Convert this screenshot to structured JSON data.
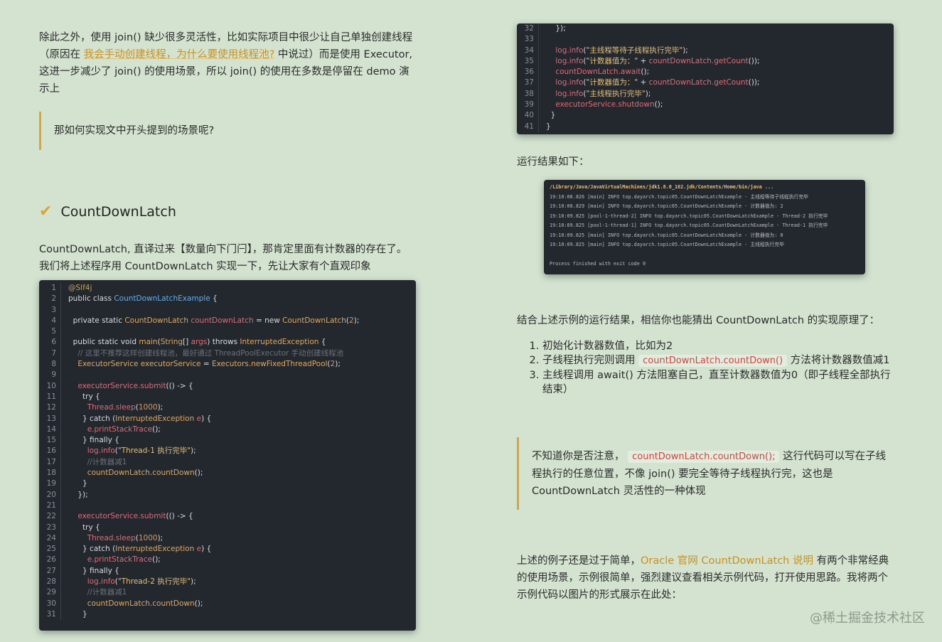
{
  "left": {
    "intro_pre": "除此之外，使用 join() 缺少很多灵活性，比如实际项目中很少让自己单独创建线程（原因在 ",
    "intro_link": "我会手动创建线程，为什么要使用线程池?",
    "intro_post": " 中说过）而是使用 Executor, 这进一步减少了 join() 的使用场景，所以 join() 的使用在多数是停留在 demo 演示上",
    "quote": "那如何实现文中开头提到的场景呢?",
    "heading": "CountDownLatch",
    "desc": "CountDownLatch, 直译过来【数量向下门闩】，那肯定里面有计数器的存在了。我们将上述程序用 CountDownLatch 实现一下，先让大家有个直观印象"
  },
  "right": {
    "result_label": "运行结果如下：",
    "summary": "结合上述示例的运行结果，相信你也能猜出 CountDownLatch 的实现原理了：",
    "steps": [
      {
        "pre": "初始化计数器数值，比如为2",
        "code": "",
        "post": ""
      },
      {
        "pre": "子线程执行完则调用 ",
        "code": "countDownLatch.countDown()",
        "post": " 方法将计数器数值减1"
      },
      {
        "pre": "主线程调用 await() 方法阻塞自己，直至计数器数值为0（即子线程全部执行结束）",
        "code": "",
        "post": ""
      }
    ],
    "quote_pre": "不知道你是否注意， ",
    "quote_code": "countDownLatch.countDown();",
    "quote_post": " 这行代码可以写在子线程执行的任意位置，不像 join() 要完全等待子线程执行完，这也是 CountDownLatch 灵活性的一种体现",
    "end_pre": "上述的例子还是过于简单，",
    "end_link": "Oracle 官网 CountDownLatch 说明",
    "end_post": " 有两个非常经典的使用场景，示例很简单，强烈建议查看相关示例代码，打开使用思路。我将两个示例代码以图片的形式展示在此处："
  },
  "terminal": [
    "/Library/Java/JavaVirtualMachines/jdk1.8.0_162.jdk/Contents/Home/bin/java ...",
    "19:10:08.826 [main] INFO top.dayarch.topic05.CountDownLatchExample - 主线程等待子线程执行完毕",
    "19:10:08.829 [main] INFO top.dayarch.topic05.CountDownLatchExample - 计数器值为: 2",
    "19:10:09.825 [pool-1-thread-2] INFO top.dayarch.topic05.CountDownLatchExample - Thread-2 执行完毕",
    "19:10:09.825 [pool-1-thread-1] INFO top.dayarch.topic05.CountDownLatchExample - Thread-1 执行完毕",
    "19:10:09.825 [main] INFO top.dayarch.topic05.CountDownLatchExample - 计数器值为: 0",
    "19:10:09.825 [main] INFO top.dayarch.topic05.CountDownLatchExample - 主线程执行完毕",
    "",
    "Process finished with exit code 0"
  ],
  "watermark": "@稀土掘金技术社区",
  "colors": {
    "background": "#d3e3d0",
    "accent": "#e0a233",
    "code_bg": "#23272e"
  }
}
